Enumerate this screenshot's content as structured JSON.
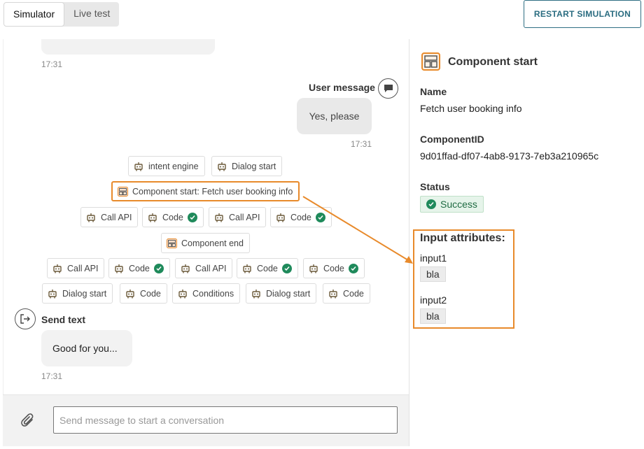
{
  "tabs": [
    {
      "label": "Simulator",
      "active": true
    },
    {
      "label": "Live test",
      "active": false
    }
  ],
  "restart_button": "RESTART SIMULATION",
  "chat": {
    "first_time": "17:31",
    "user_message": {
      "label": "User message",
      "text": "Yes, please",
      "time": "17:31"
    },
    "flow_nodes": {
      "row1": [
        {
          "label": "intent engine",
          "icon": "robot-icon"
        },
        {
          "label": "Dialog start",
          "icon": "robot-icon"
        }
      ],
      "row2": [
        {
          "label": "Component start: Fetch user booking info",
          "icon": "component-icon",
          "highlighted": true
        }
      ],
      "row3": [
        {
          "label": "Call API",
          "icon": "robot-icon",
          "check": false
        },
        {
          "label": "Code",
          "icon": "robot-icon",
          "check": true
        },
        {
          "label": "Call API",
          "icon": "robot-icon",
          "check": false
        },
        {
          "label": "Code",
          "icon": "robot-icon",
          "check": true
        }
      ],
      "row4": [
        {
          "label": "Component end",
          "icon": "component-icon"
        }
      ],
      "row5": [
        {
          "label": "Call API",
          "icon": "robot-icon",
          "check": false
        },
        {
          "label": "Code",
          "icon": "robot-icon",
          "check": true
        },
        {
          "label": "Call API",
          "icon": "robot-icon",
          "check": false
        },
        {
          "label": "Code",
          "icon": "robot-icon",
          "check": true
        },
        {
          "label": "Code",
          "icon": "robot-icon",
          "check": true
        }
      ],
      "row6": [
        {
          "label": "Dialog start",
          "icon": "robot-icon"
        },
        {
          "label": "Code",
          "icon": "robot-icon"
        },
        {
          "label": "Conditions",
          "icon": "robot-icon"
        },
        {
          "label": "Dialog start",
          "icon": "robot-icon"
        },
        {
          "label": "Code",
          "icon": "robot-icon"
        }
      ]
    },
    "bot_message": {
      "label": "Send text",
      "text": "Good for you...",
      "time": "17:31"
    }
  },
  "composer": {
    "placeholder": "Send message to start a conversation"
  },
  "panel": {
    "title": "Component start",
    "name_label": "Name",
    "name_value": "Fetch user booking info",
    "id_label": "ComponentID",
    "id_value": "9d01ffad-df07-4ab8-9173-7eb3a210965c",
    "status_label": "Status",
    "status_value": "Success",
    "attributes_title": "Input attributes:",
    "attributes": [
      {
        "name": "input1",
        "value": "bla"
      },
      {
        "name": "input2",
        "value": "bla"
      }
    ]
  },
  "colors": {
    "accent_orange": "#e88a2b",
    "success_green": "#1f8a5b",
    "primary_teal": "#2a6c80"
  }
}
